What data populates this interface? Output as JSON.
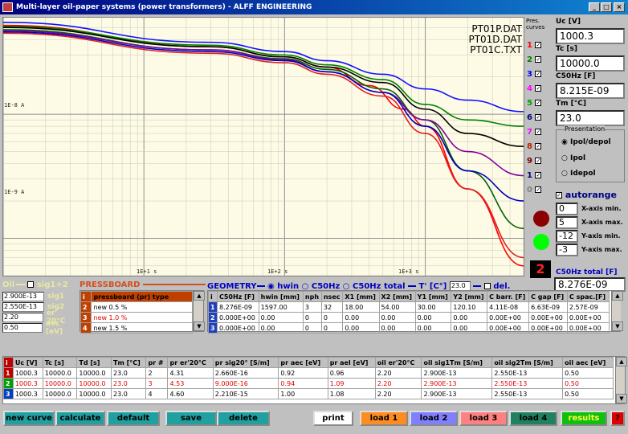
{
  "window": {
    "title": "Multi-layer oil-paper systems (power transformers) - ALFF ENGINEERING",
    "controls": [
      "_",
      "□",
      "×"
    ]
  },
  "plot": {
    "files": [
      "PT01P.DAT",
      "PT01D.DAT",
      "PT01C.TXT"
    ],
    "ylabels": [
      "1E-8 A",
      "1E-9 A"
    ],
    "xlabels": [
      "1E+1 s",
      "1E+2 s",
      "1E+3 s"
    ]
  },
  "chart_data": {
    "type": "line",
    "title": "",
    "xlabel": "",
    "ylabel": "",
    "xscale": "log",
    "yscale": "log",
    "xlim": [
      1,
      5000
    ],
    "ylim": [
      5e-10,
      6e-08
    ],
    "grid": true,
    "series": [
      {
        "color": "#1010ff",
        "x": [
          1,
          30,
          100,
          200,
          500,
          1000,
          2000,
          5000
        ],
        "y": [
          5.5e-08,
          3.8e-08,
          3.2e-08,
          2.7e-08,
          2.1e-08,
          1.6e-08,
          1.3e-08,
          1.05e-08
        ]
      },
      {
        "color": "#ff0000",
        "x": [
          1,
          30,
          100,
          200,
          400,
          700,
          1000,
          2000,
          5000
        ],
        "y": [
          5.2e-08,
          3.5e-08,
          2.9e-08,
          2.4e-08,
          1.7e-08,
          1.1e-08,
          8e-09,
          2.5e-09,
          6e-10
        ]
      },
      {
        "color": "#008000",
        "x": [
          1,
          30,
          100,
          200,
          500,
          1000,
          2000,
          5000
        ],
        "y": [
          5.1e-08,
          3.6e-08,
          3e-08,
          2.5e-08,
          1.9e-08,
          1.2e-08,
          9e-09,
          8e-09
        ]
      },
      {
        "color": "#000000",
        "x": [
          1,
          30,
          100,
          200,
          500,
          1000,
          2000,
          5000
        ],
        "y": [
          5e-08,
          3.5e-08,
          2.9e-08,
          2.4e-08,
          1.8e-08,
          1.1e-08,
          7e-09,
          5.5e-09
        ]
      },
      {
        "color": "#006000",
        "x": [
          1,
          30,
          100,
          200,
          500,
          1000,
          2000,
          5000
        ],
        "y": [
          4.8e-08,
          3.3e-08,
          2.8e-08,
          2.3e-08,
          1.6e-08,
          9e-09,
          3.5e-09,
          1.2e-09
        ]
      },
      {
        "color": "#8000a0",
        "x": [
          1,
          30,
          100,
          200,
          500,
          1000,
          2000,
          5000
        ],
        "y": [
          4.7e-08,
          3.3e-08,
          2.75e-08,
          2.2e-08,
          1.5e-08,
          9e-09,
          5e-09,
          3.2e-09
        ]
      },
      {
        "color": "#0000c0",
        "x": [
          1,
          30,
          100,
          200,
          500,
          1000,
          2000,
          5000
        ],
        "y": [
          4.6e-08,
          3.2e-08,
          2.7e-08,
          2.2e-08,
          1.5e-08,
          8e-09,
          3.5e-09,
          2e-09
        ]
      },
      {
        "color": "#e02020",
        "x": [
          1,
          30,
          100,
          200,
          500,
          1000,
          2000,
          5000
        ],
        "y": [
          4.5e-08,
          3.1e-08,
          2.6e-08,
          2.1e-08,
          1.4e-08,
          7e-09,
          2.5e-09,
          7e-10
        ]
      }
    ]
  },
  "curves": {
    "header": [
      "Pres.",
      "curves"
    ],
    "items": [
      {
        "num": "1",
        "color": "#ff0000"
      },
      {
        "num": "2",
        "color": "#008000"
      },
      {
        "num": "3",
        "color": "#0000ff"
      },
      {
        "num": "4",
        "color": "#ff00ff"
      },
      {
        "num": "5",
        "color": "#00a000"
      },
      {
        "num": "6",
        "color": "#000080"
      },
      {
        "num": "7",
        "color": "#ff00ff"
      },
      {
        "num": "8",
        "color": "#c02000"
      },
      {
        "num": "9",
        "color": "#800000"
      },
      {
        "num": "1",
        "color": "#000080"
      },
      {
        "num": "0",
        "color": "#808080"
      }
    ]
  },
  "right": {
    "uc_label": "Uc [V]",
    "uc": "1000.3",
    "tc_label": "Tc [s]",
    "tc": "10000.0",
    "c50_label": "C50Hz [F]",
    "c50": "8.215E-09",
    "tm_label": "Tm [°C]",
    "tm": "23.0",
    "presentation": "Presentation",
    "radios": [
      "Ipol/depol",
      "Ipol",
      "Idepol"
    ],
    "autorange": "autorange",
    "axes": [
      {
        "value": "0",
        "label": "X-axis min."
      },
      {
        "value": "5",
        "label": "X-axis max."
      },
      {
        "value": "-12",
        "label": "Y-axis min."
      },
      {
        "value": "-3",
        "label": "Y-axis max."
      }
    ],
    "counter": "2",
    "c50total_label": "C50Hz total [F]",
    "c50total": "8.276E-09"
  },
  "oil": {
    "label": "Oil",
    "sig_label": "sig1+2",
    "rows": [
      {
        "value": "2.900E-13",
        "label": "sig1"
      },
      {
        "value": "2.550E-13",
        "label": "sig2"
      },
      {
        "value": "2.20",
        "label": "er' 20°C"
      },
      {
        "value": "0.50",
        "label": "aec [eV]"
      }
    ]
  },
  "pressboard": {
    "title": "PRESSBOARD",
    "header": [
      "i",
      "pressboard (pr) type"
    ],
    "rows": [
      {
        "i": "2",
        "type": "new  0.5 %"
      },
      {
        "i": "3",
        "type": "new  1.0 %"
      },
      {
        "i": "4",
        "type": "new  1.5 %"
      }
    ]
  },
  "geometry": {
    "title": "GEOMETRY",
    "radios": [
      "hwin",
      "C50Hz",
      "C50Hz total"
    ],
    "t_label": "T' [C°]",
    "t_value": "23.0",
    "del": "del.",
    "header": [
      "i",
      "C50Hz [F]",
      "hwin [mm]",
      "nph",
      "nsec",
      "X1 [mm]",
      "X2 [mm]",
      "Y1 [mm]",
      "Y2 [mm]",
      "C barr. [F]",
      "C gap [F]",
      "C spac.[F]"
    ],
    "rows": [
      [
        "1",
        "8.276E-09",
        "1597.00",
        "3",
        "32",
        "18.00",
        "54.00",
        "30.00",
        "120.10",
        "4.11E-08",
        "6.63E-09",
        "2.57E-09"
      ],
      [
        "2",
        "0.000E+00",
        "0.00",
        "0",
        "0",
        "0.00",
        "0.00",
        "0.00",
        "0.00",
        "0.00E+00",
        "0.00E+00",
        "0.00E+00"
      ],
      [
        "3",
        "0.000E+00",
        "0.00",
        "0",
        "0",
        "0.00",
        "0.00",
        "0.00",
        "0.00",
        "0.00E+00",
        "0.00E+00",
        "0.00E+00"
      ]
    ]
  },
  "bottom": {
    "header": [
      "i",
      "Uc [V]",
      "Tc [s]",
      "Td [s]",
      "Tm [°C]",
      "pr #",
      "pr er'20°C",
      "pr sig20° [S/m]",
      "pr aec [eV]",
      "pr ael [eV]",
      "oil er'20°C",
      "oil sig1Tm [S/m]",
      "oil sig2Tm [S/m]",
      "oil aec [eV]"
    ],
    "rows": [
      [
        "1",
        "1000.3",
        "10000.0",
        "10000.0",
        "23.0",
        "2",
        "4.31",
        "2.660E-16",
        "0.92",
        "0.96",
        "2.20",
        "2.900E-13",
        "2.550E-13",
        "0.50"
      ],
      [
        "2",
        "1000.3",
        "10000.0",
        "10000.0",
        "23.0",
        "3",
        "4.53",
        "9.000E-16",
        "0.94",
        "1.09",
        "2.20",
        "2.900E-13",
        "2.550E-13",
        "0.50"
      ],
      [
        "3",
        "1000.3",
        "10000.0",
        "10000.0",
        "23.0",
        "4",
        "4.60",
        "2.210E-15",
        "1.00",
        "1.08",
        "2.20",
        "2.900E-13",
        "2.550E-13",
        "0.50"
      ]
    ]
  },
  "buttons": {
    "new_curve": "new curve",
    "calculate": "calculate",
    "default": "default",
    "save": "save",
    "delete": "delete",
    "print": "print",
    "load1": "load 1",
    "load2": "load 2",
    "load3": "load 3",
    "load4": "load 4",
    "results": "results",
    "exit": "?"
  }
}
